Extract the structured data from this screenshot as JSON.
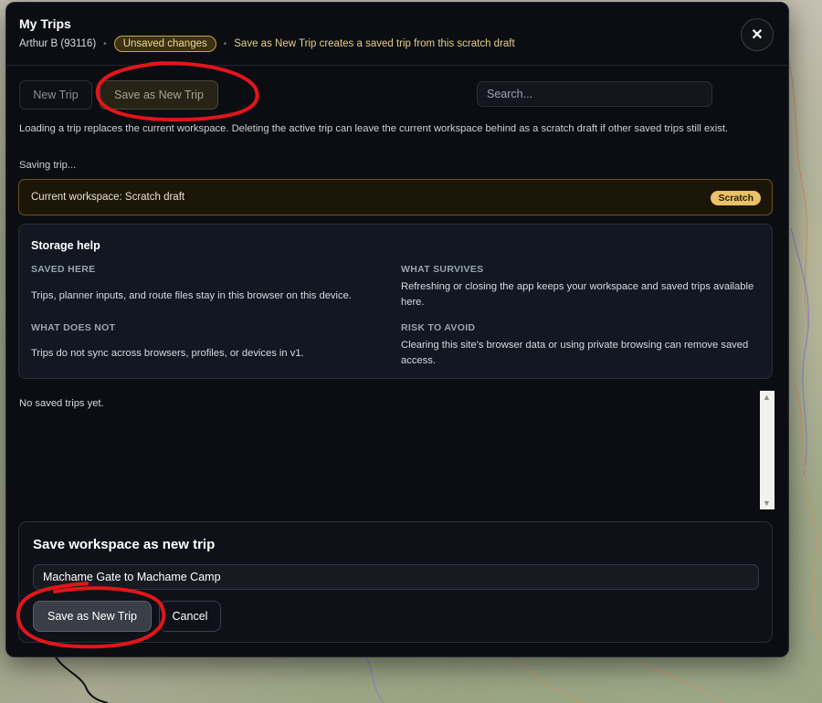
{
  "header": {
    "title": "My Trips",
    "user": "Arthur B (93116)",
    "unsaved_badge": "Unsaved changes",
    "hint": "Save as New Trip creates a saved trip from this scratch draft",
    "close_glyph": "✕"
  },
  "toolbar": {
    "new_trip_label": "New Trip",
    "save_as_new_label": "Save as New Trip",
    "search_placeholder": "Search..."
  },
  "info_text": "Loading a trip replaces the current workspace. Deleting the active trip can leave the current workspace behind as a scratch draft if other saved trips still exist.",
  "status_text": "Saving trip...",
  "workspace": {
    "label": "Current workspace: Scratch draft",
    "badge": "Scratch"
  },
  "storage_help": {
    "title": "Storage help",
    "saved_here": {
      "heading": "SAVED HERE",
      "body": "Trips, planner inputs, and route files stay in this browser on this device."
    },
    "what_survives": {
      "heading": "WHAT SURVIVES",
      "body": "Refreshing or closing the app keeps your workspace and saved trips available here."
    },
    "what_does_not": {
      "heading": "WHAT DOES NOT",
      "body": "Trips do not sync across browsers, profiles, or devices in v1."
    },
    "risk": {
      "heading": "RISK TO AVOID",
      "body": "Clearing this site's browser data or using private browsing can remove saved access."
    }
  },
  "trip_list": {
    "empty_text": "No saved trips yet."
  },
  "save_panel": {
    "title": "Save workspace as new trip",
    "name_value": "Machame Gate to Machame Camp",
    "save_label": "Save as New Trip",
    "cancel_label": "Cancel"
  },
  "colors": {
    "modal_bg": "#0b0d12",
    "accent_gold": "#e9c166",
    "annotation_red": "#e0161a"
  }
}
